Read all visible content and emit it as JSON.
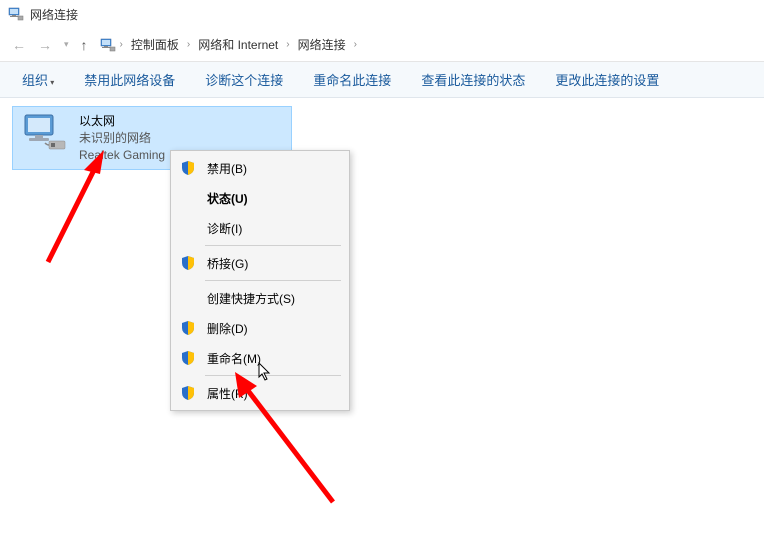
{
  "window": {
    "title": "网络连接"
  },
  "breadcrumb": {
    "items": [
      "控制面板",
      "网络和 Internet",
      "网络连接"
    ]
  },
  "toolbar": {
    "organize": "组织",
    "disable": "禁用此网络设备",
    "diagnose": "诊断这个连接",
    "rename": "重命名此连接",
    "status": "查看此连接的状态",
    "settings": "更改此连接的设置"
  },
  "network": {
    "name": "以太网",
    "status": "未识别的网络",
    "adapter": "Realtek Gaming"
  },
  "contextMenu": {
    "disable": "禁用(B)",
    "status": "状态(U)",
    "diagnose": "诊断(I)",
    "bridge": "桥接(G)",
    "shortcut": "创建快捷方式(S)",
    "delete": "删除(D)",
    "rename": "重命名(M)",
    "properties": "属性(R)"
  }
}
